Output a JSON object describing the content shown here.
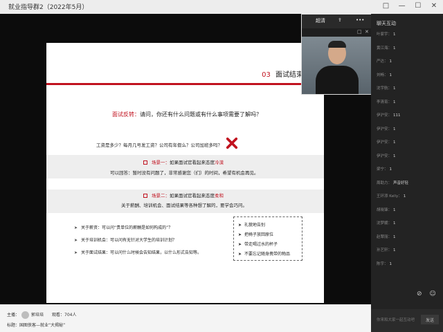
{
  "window": {
    "title": "就业指导群2（2022年5月）",
    "controls": [
      "□",
      "—",
      "☐",
      "✕"
    ]
  },
  "slide": {
    "section_number": "03",
    "section_title": "面试结束细节",
    "question_label": "面试反转：",
    "question_text": "请问，你还有什么问题或有什么事项需要了解吗？",
    "salary_question": "工资是多少？每月几号发工资？公司有年假么？公司加班多吗？",
    "scene1_prefix": "场景一：",
    "scene1_text": "如果面试官看起来态度",
    "scene1_highlight": "冷漠",
    "scene1_answer": "可以回答：暂时没有问题了，非常感谢您（们）的时间，希望有机会再见。",
    "scene2_prefix": "场景二：",
    "scene2_text": "如果面试官看起来态度",
    "scene2_highlight": "柔和",
    "scene2_answer": "关于薪酬、培训机会、面试结果等各种想了解的，要学会巧问。",
    "bullets": [
      "关于薪资：可以问“贵单位的薪酬是如何构成的”？",
      "关于培训机会：可以问有无针对大学生的培训计划？",
      "关于面试结果：可以问什么时候会告知结果，以什么形式告知等。"
    ],
    "tips": [
      "礼貌地告别",
      "把椅子放回原位",
      "带走喝过水的杯子",
      "不要忘记随身携带的物品"
    ]
  },
  "camera": {
    "button1": "超清",
    "button2": "⇪",
    "button3": "•••",
    "controls": [
      "□",
      "✕"
    ]
  },
  "chat": {
    "header": "聊天互动",
    "messages": [
      {
        "user": "叶家宇：",
        "text": "1"
      },
      {
        "user": "黄江海：",
        "text": "1"
      },
      {
        "user": "严达：",
        "text": "1"
      },
      {
        "user": "刘畅：",
        "text": "1"
      },
      {
        "user": "沈宇航：",
        "text": "1"
      },
      {
        "user": "李清宵：",
        "text": "1"
      },
      {
        "user": "伊沪安：",
        "text": "111"
      },
      {
        "user": "伊沪安：",
        "text": "1"
      },
      {
        "user": "伊沪安：",
        "text": "1"
      },
      {
        "user": "伊沪安：",
        "text": "1"
      },
      {
        "user": "梁宁：",
        "text": "1"
      },
      {
        "user": "周助力：",
        "text": "声音好轻"
      },
      {
        "user": "王环添 Kelly：",
        "text": "1"
      },
      {
        "user": "胡晓锋：",
        "text": "1"
      },
      {
        "user": "沈梦媛：",
        "text": "1"
      },
      {
        "user": "赵翠丽：",
        "text": "1"
      },
      {
        "user": "孙艺轩：",
        "text": "1"
      },
      {
        "user": "陈宇：",
        "text": "1"
      }
    ],
    "input_placeholder": "你来和大家一起互动吧",
    "send_label": "发送"
  },
  "footer": {
    "host_label": "主播：",
    "host_name": "郭培培",
    "viewers_label": "观看：",
    "viewers_count": "704人",
    "topic_label": "标题：",
    "topic": "国图侠客—就业“大揭秘”"
  }
}
